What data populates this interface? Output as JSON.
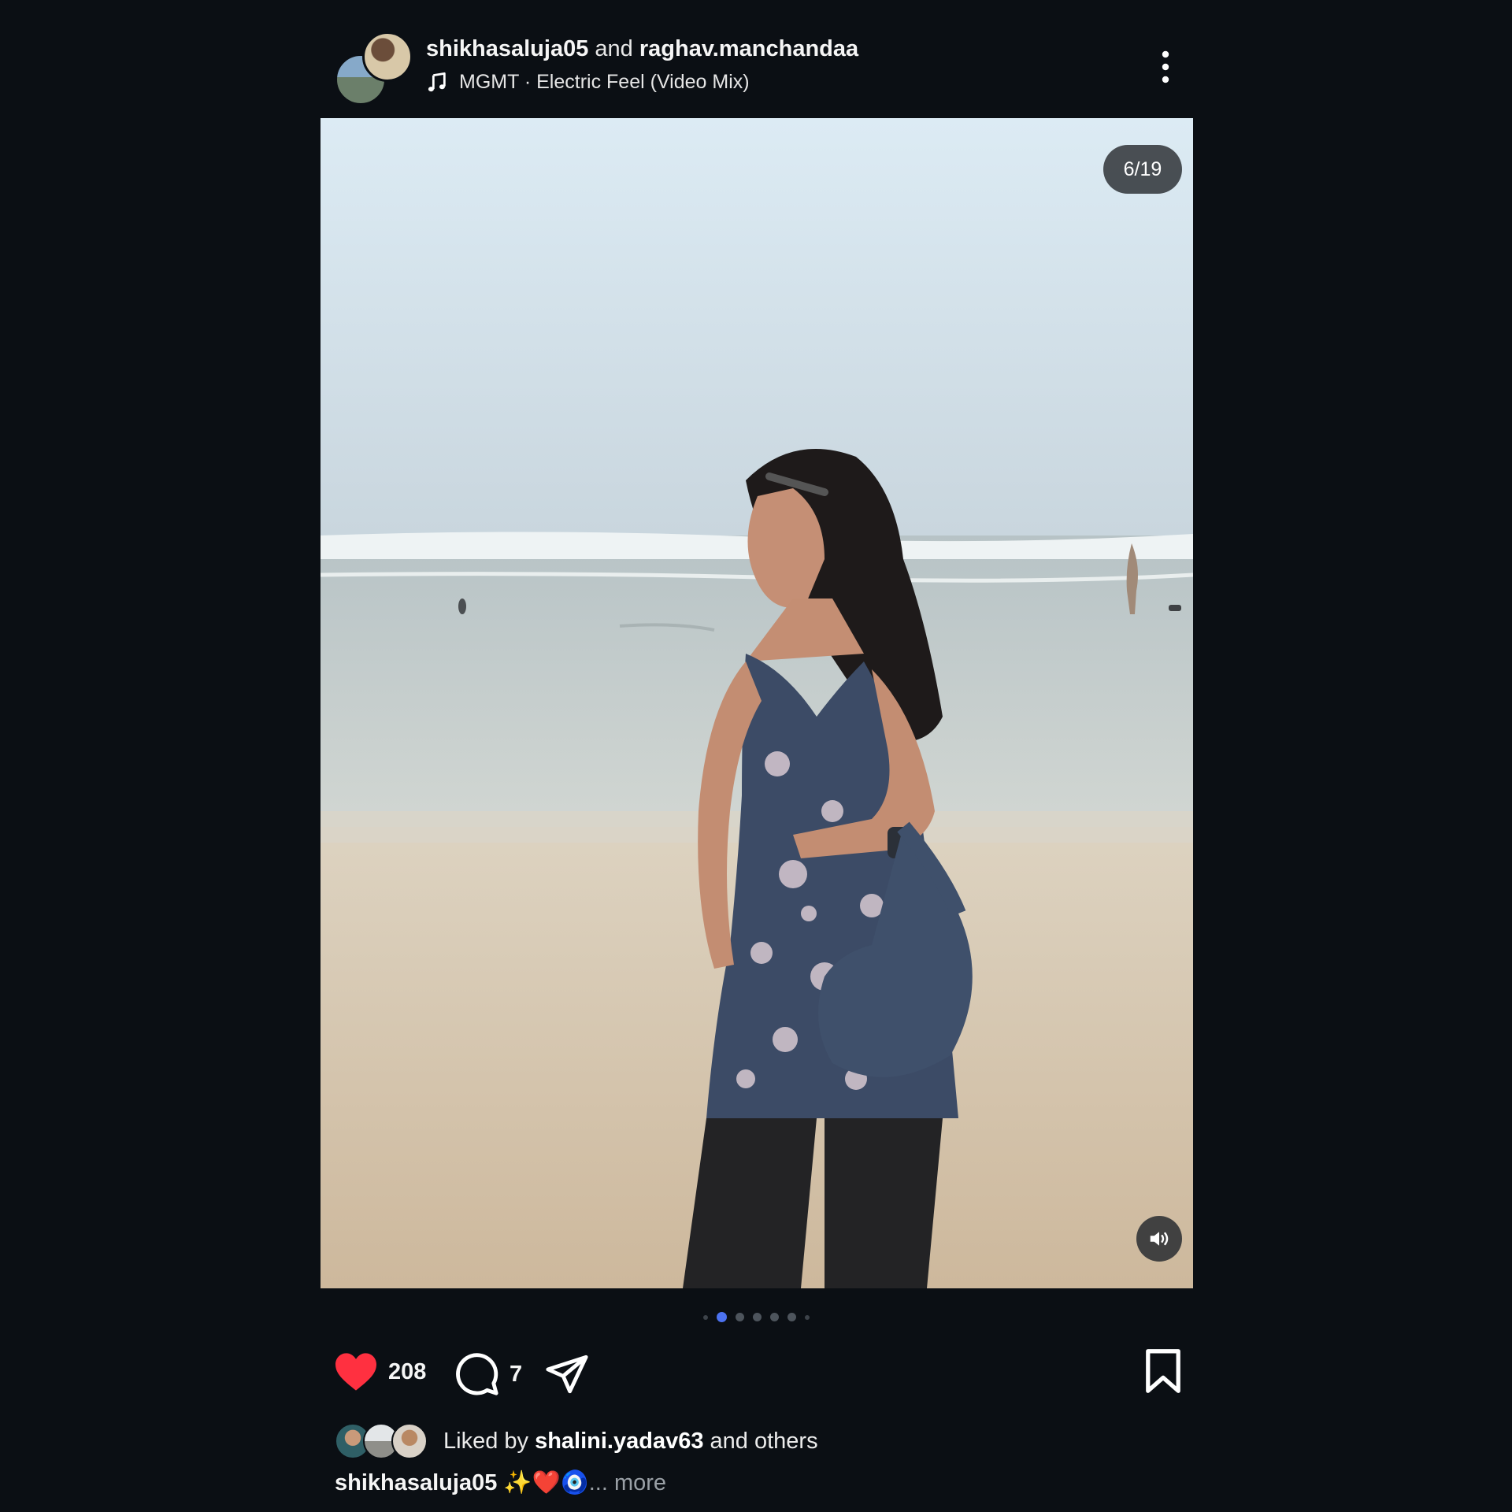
{
  "header": {
    "user_primary": "shikhasaluja05",
    "conjunction": "and",
    "user_secondary": "raghav.manchandaa",
    "audio_track": "MGMT · Electric Feel (Video Mix)",
    "icons": [
      "music-note-icon",
      "more-vertical-icon"
    ]
  },
  "media": {
    "counter": "6/19",
    "sound_icon": "speaker-icon",
    "carousel": {
      "total_dots_shown": 7,
      "active_index": 1
    }
  },
  "actions": {
    "like_count": "208",
    "comment_count": "7",
    "icons": [
      "heart-filled-icon",
      "comment-icon",
      "send-icon",
      "bookmark-icon"
    ],
    "like_color": "#ff3040"
  },
  "likes": {
    "prefix": "Liked by",
    "user": "shalini.yadav63",
    "suffix": "and others"
  },
  "caption": {
    "user": "shikhasaluja05",
    "text": "✨❤️🧿",
    "more": "... more"
  }
}
